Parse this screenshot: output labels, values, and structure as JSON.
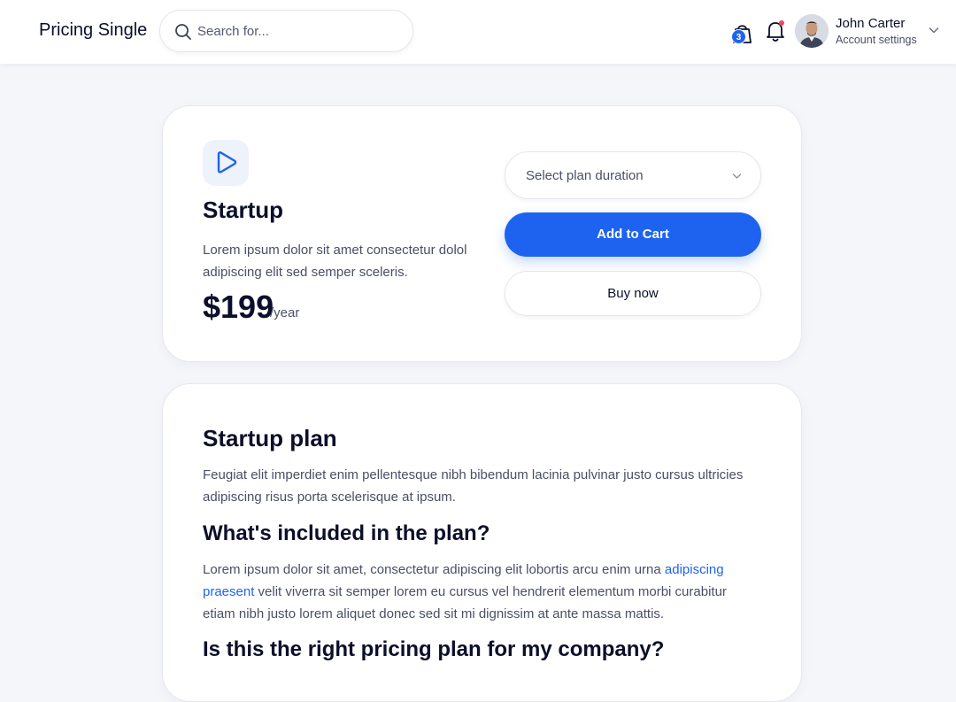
{
  "header": {
    "title": "Pricing Single",
    "search_placeholder": "Search for...",
    "cart_count": "3",
    "user_name": "John Carter",
    "user_subtitle": "Account settings"
  },
  "plan": {
    "icon": "play-icon",
    "name": "Startup",
    "description": "Lorem ipsum dolor sit amet consectetur dolol adipiscing elit sed semper sceleris.",
    "price": "$199",
    "period": "/year",
    "select_placeholder": "Select plan duration",
    "add_to_cart_label": "Add to Cart",
    "buy_now_label": "Buy now"
  },
  "details": {
    "title": "Startup plan",
    "intro": "Feugiat elit imperdiet enim pellentesque nibh bibendum lacinia pulvinar justo cursus ultricies adipiscing risus porta scelerisque at ipsum.",
    "included_heading": "What's included in the plan?",
    "included_text_before": "Lorem ipsum dolor sit amet, consectetur adipiscing elit lobortis arcu enim urna ",
    "included_link": "adipiscing praesent",
    "included_text_after": " velit viverra sit semper lorem eu cursus vel hendrerit elementum morbi curabitur etiam nibh justo lorem aliquet donec sed sit mi dignissim at ante massa mattis.",
    "question_heading": "Is this the right pricing plan for my company?"
  },
  "colors": {
    "accent": "#1e63f0",
    "text_dark": "#0b0f2a",
    "text_muted": "#4a4f66",
    "background": "#f5f6fa",
    "notification_dot": "#f0475a"
  }
}
